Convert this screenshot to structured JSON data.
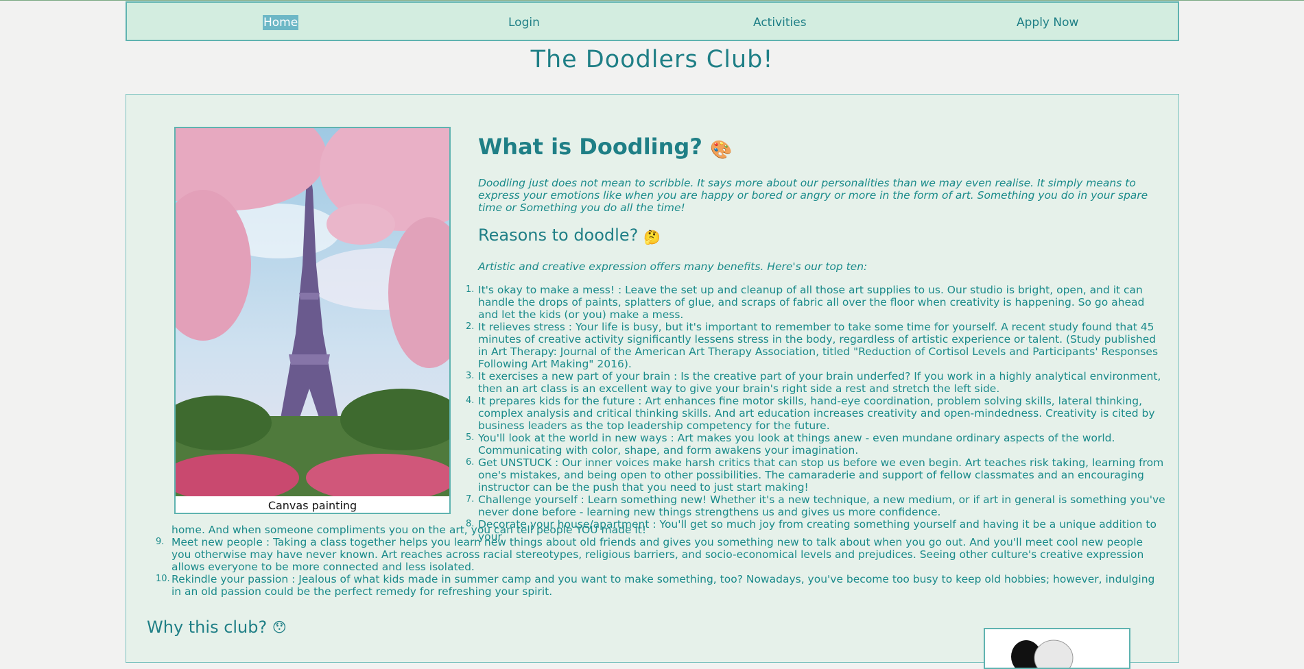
{
  "nav": {
    "home": "Home",
    "login": "Login",
    "activities": "Activities",
    "apply": "Apply Now"
  },
  "site_title": "The Doodlers Club!",
  "figure": {
    "caption": "Canvas painting"
  },
  "what": {
    "heading": "What is Doodling?",
    "emoji": "🎨",
    "intro": "Doodling just does not mean to scribble. It says more about our personalities than we may even realise. It simply means to express your emotions like when you are happy or bored or angry or more in the form of art. Something you do in your spare time or Something you do all the time!"
  },
  "reasons": {
    "heading": "Reasons to doodle?",
    "emoji": "🤔",
    "lead": "Artistic and creative expression offers many benefits. Here's our top ten:",
    "items": [
      "It's okay to make a mess! : Leave the set up and cleanup of all those art supplies to us. Our studio is bright, open, and it can handle the drops of paints, splatters of glue, and scraps of fabric all over the floor when creativity is happening. So go ahead and let the kids (or you) make a mess.",
      "It relieves stress : Your life is busy, but it's important to remember to take some time for yourself. A recent study found that 45 minutes of creative activity significantly lessens stress in the body, regardless of artistic experience or talent. (Study published in Art Therapy: Journal of the American Art Therapy Association, titled \"Reduction of Cortisol Levels and Participants' Responses Following Art Making\" 2016).",
      "It exercises a new part of your brain : Is the creative part of your brain underfed? If you work in a highly analytical environment, then an art class is an excellent way to give your brain's right side a rest and stretch the left side.",
      "It prepares kids for the future : Art enhances fine motor skills, hand-eye coordination, problem solving skills, lateral thinking, complex analysis and critical thinking skills. And art education increases creativity and open-mindedness. Creativity is cited by business leaders as the top leadership competency for the future.",
      "You'll look at the world in new ways : Art makes you look at things anew - even mundane ordinary aspects of the world. Communicating with color, shape, and form awakens your imagination.",
      "Get UNSTUCK : Our inner voices make harsh critics that can stop us before we even begin. Art teaches risk taking, learning from one's mistakes, and being open to other possibilities. The camaraderie and support of fellow classmates and an encouraging instructor can be the push that you need to just start making!",
      "Challenge yourself : Learn something new! Whether it's a new technique, a new medium, or if art in general is something you've never done before - learning new things strengthens us and gives us more confidence.",
      "Decorate your house/apartment : You'll get so much joy from creating something yourself and having it be a unique addition to your",
      "home. And when someone compliments you on the art, you can tell people YOU made it!",
      "Meet new people : Taking a class together helps you learn new things about old friends and gives you something new to talk about when you go out. And you'll meet cool new people you otherwise may have never known. Art reaches across racial stereotypes, religious barriers, and socio-economical levels and prejudices. Seeing other culture's creative expression allows everyone to be more connected and less isolated.",
      "Rekindle your passion : Jealous of what kids made in summer camp and you want to make something, too? Nowadays, you've become too busy to keep old hobbies; however, indulging in an old passion could be the perfect remedy for refreshing your spirit."
    ],
    "numbers": [
      "1.",
      "2.",
      "3.",
      "4.",
      "5.",
      "6.",
      "7.",
      "8.",
      "9.",
      "10."
    ]
  },
  "why": {
    "heading": "Why this club?",
    "emoji": "😯"
  }
}
